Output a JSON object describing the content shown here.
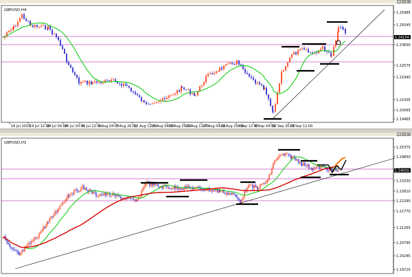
{
  "windows": [
    {
      "title": "GBPUSD,H4",
      "price_axis": [
        "1.25985",
        "1.25045",
        "1.24105",
        "1.23600",
        "1.22575",
        "1.21940",
        "1.21005",
        "1.20065",
        "1.19465"
      ],
      "current_price": "1.24154",
      "time_axis": [
        "18 Jul 2019",
        "19 Jul 12:00",
        "24 Jul 04:00",
        "26 Jul 20:00",
        "31 Jul 12:00",
        "5 Aug 04:00",
        "7 Aug 20:00",
        "12 Aug 12:00",
        "15 Aug 04:00",
        "19 Aug 20:00",
        "22 Aug 12:00",
        "27 Aug 04:00",
        "29 Aug 20:00",
        "3 Sep 12:00",
        "6 Sep 04:00",
        "10 Sep 20:00",
        "13 Sep 12:00"
      ]
    },
    {
      "title": "GBPUSD,H1",
      "price_axis": [
        "1.25375",
        "1.24850",
        "1.24090",
        "1.23830",
        "1.23330",
        "1.22810",
        "1.22290",
        "1.21770",
        "1.21265",
        "1.20745",
        "1.20245",
        "1.19725"
      ],
      "current_price": "1.24059",
      "time_axis": []
    }
  ],
  "colors": {
    "bull": "#ff2a00",
    "bear": "#1414c8",
    "ma_fast": "#00c800",
    "ma_slow": "#d40000",
    "level": "#aa00aa",
    "trendline": "#000000",
    "annotation": "#ff7a00"
  },
  "icons": [
    "minimize-icon",
    "maximize-icon",
    "close-icon"
  ]
}
